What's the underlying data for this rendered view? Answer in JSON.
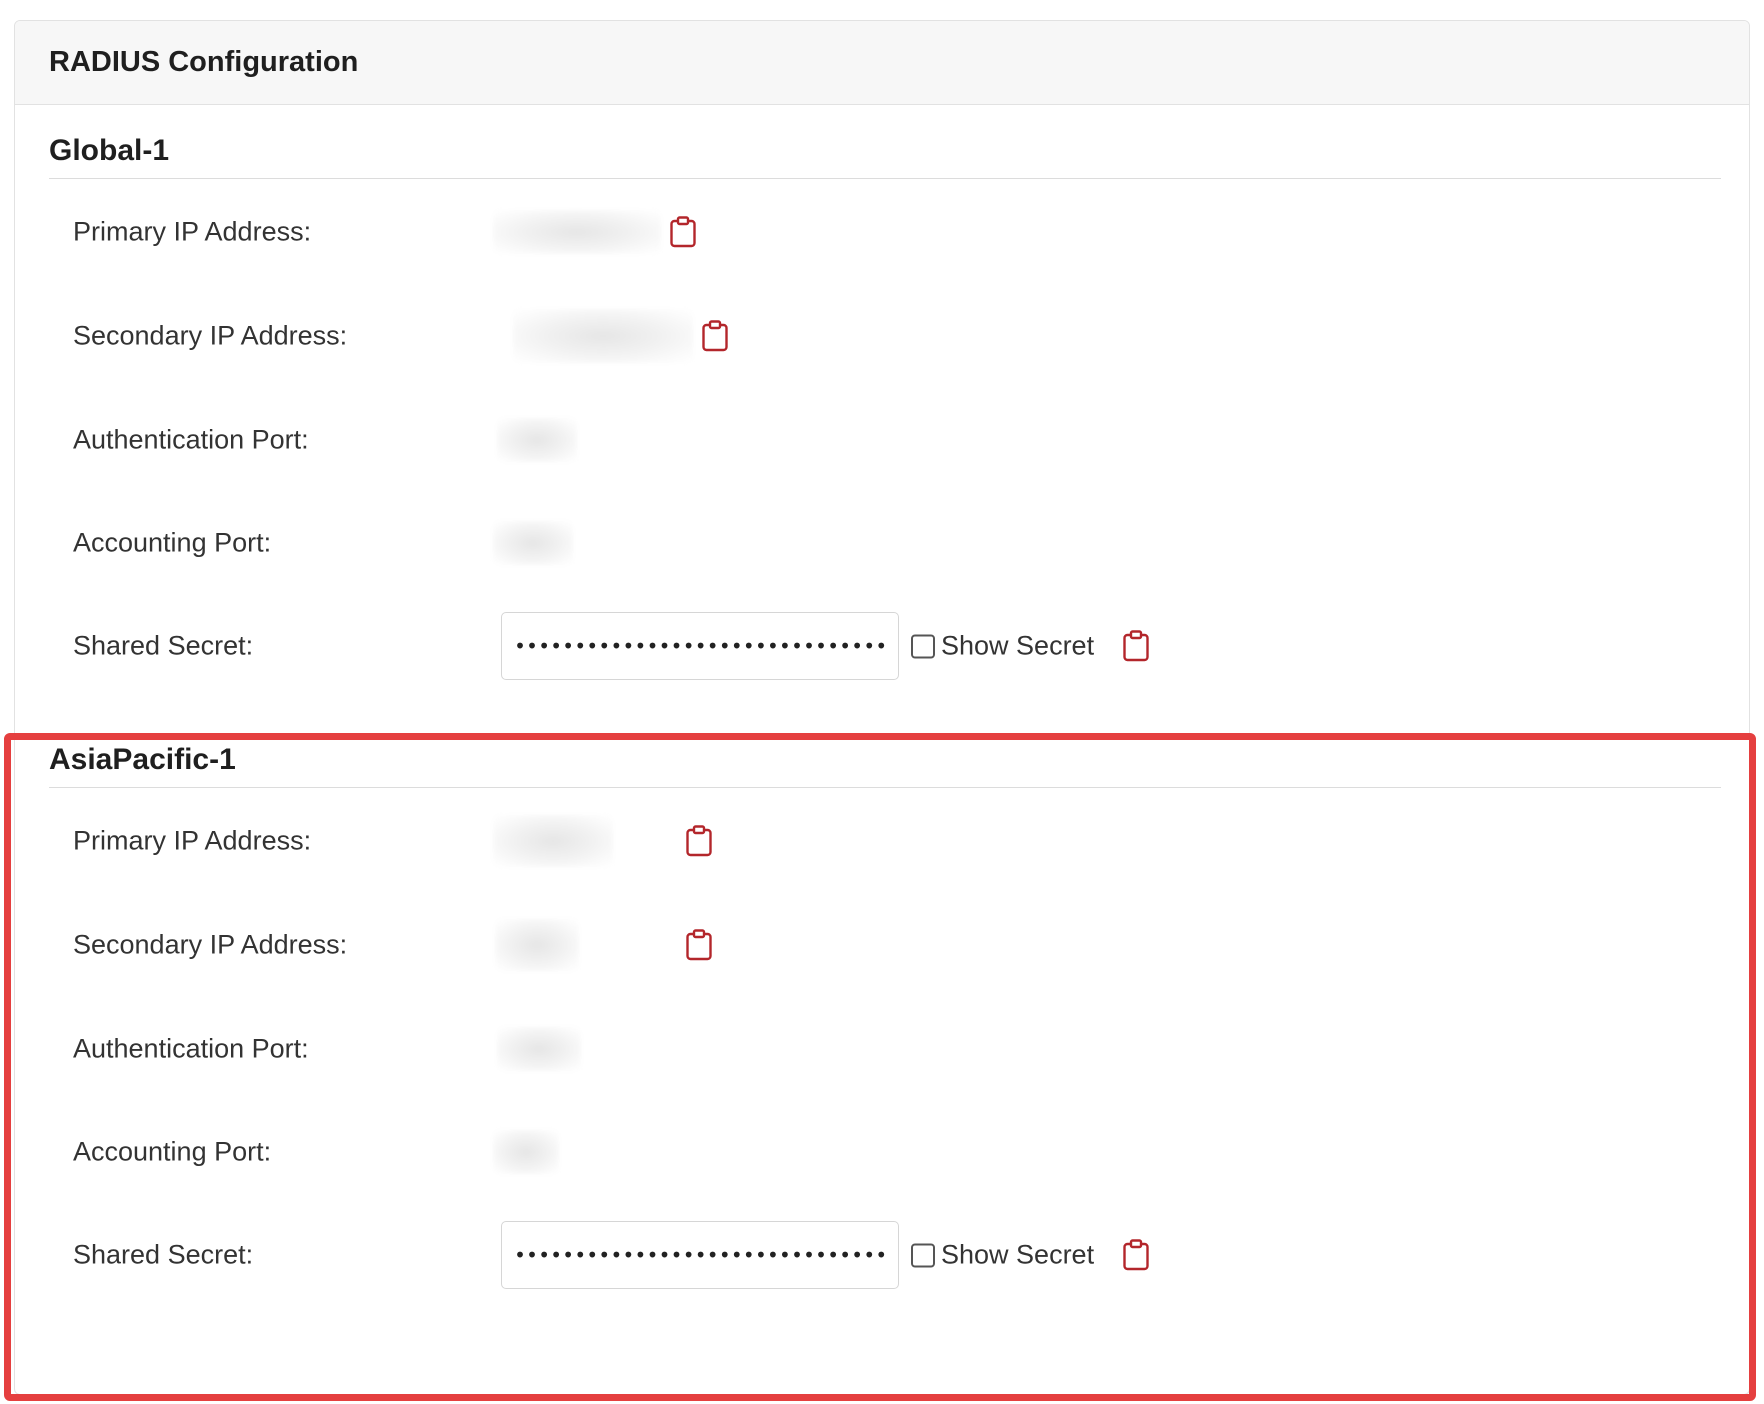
{
  "card": {
    "title": "RADIUS Configuration"
  },
  "sections": [
    {
      "title": "Global-1",
      "primary_label": "Primary IP Address:",
      "secondary_label": "Secondary IP Address:",
      "auth_label": "Authentication Port:",
      "acct_label": "Accounting Port:",
      "secret_label": "Shared Secret:",
      "secret_value": "••••••••••••••••••••••••••••••••",
      "show_secret_label": "Show Secret"
    },
    {
      "title": "AsiaPacific-1",
      "primary_label": "Primary IP Address:",
      "secondary_label": "Secondary IP Address:",
      "auth_label": "Authentication Port:",
      "acct_label": "Accounting Port:",
      "secret_label": "Shared Secret:",
      "secret_value": "••••••••••••••••••••••••••••••••",
      "show_secret_label": "Show Secret"
    }
  ],
  "icons": {
    "copy": "clipboard-icon"
  },
  "colors": {
    "accent": "#b3262b",
    "highlight": "#e53f3f"
  }
}
